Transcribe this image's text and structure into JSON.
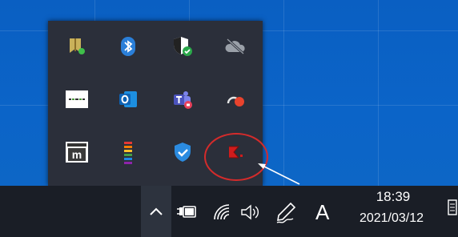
{
  "colors": {
    "desktop": "#0b64c8",
    "flyout": "#2b2f3a",
    "taskbar": "#1a1e26",
    "annotation": "#d42b2b",
    "shield_check": "#2aa84a"
  },
  "tray_icons": [
    [
      "bookmark-green-dot-icon",
      "bluetooth-icon",
      "security-shield-icon",
      "cloud-offline-icon"
    ],
    [
      "app-logo-icon",
      "outlook-icon",
      "teams-icon",
      "record-icon"
    ],
    [
      "m-box-icon",
      "equalizer-icon",
      "shield-check-icon",
      "sigma-red-icon"
    ]
  ],
  "taskbar": {
    "chevron": "chevron-up-icon",
    "power": "battery-plug-icon",
    "wifi": "wifi-icon",
    "volume": "speaker-icon",
    "pen": "pen-icon",
    "ime_label": "A",
    "time": "18:39",
    "date": "2021/03/12"
  }
}
